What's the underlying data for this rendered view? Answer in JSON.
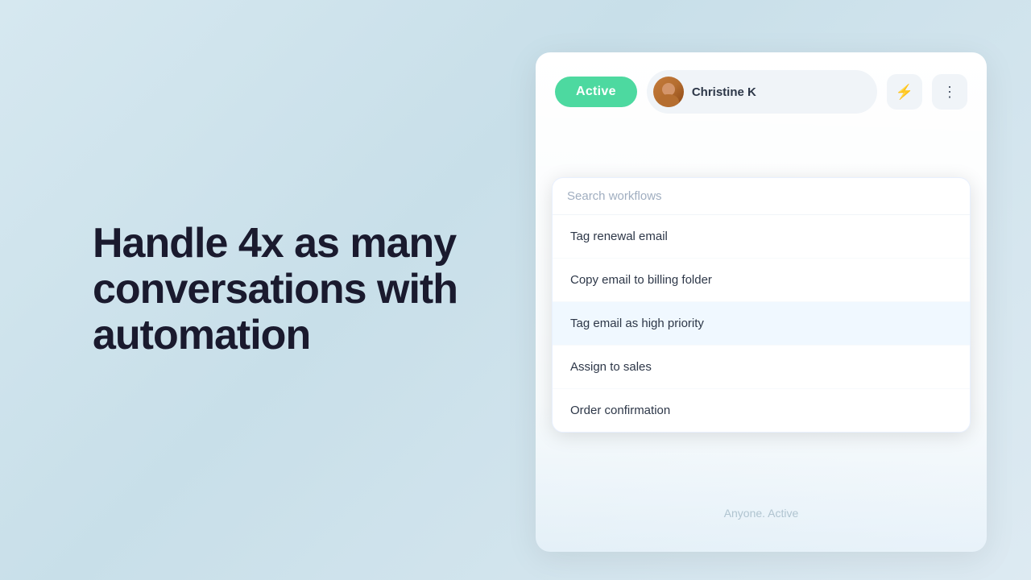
{
  "background": {
    "color_start": "#d6e8f0",
    "color_end": "#ddeef5"
  },
  "left": {
    "headline": "Handle 4x as many conversations with automation"
  },
  "panel": {
    "active_badge": "Active",
    "user_name": "Christine K",
    "search_placeholder": "Search workflows",
    "menu_items": [
      {
        "id": "tag-renewal",
        "label": "Tag renewal email",
        "highlighted": false
      },
      {
        "id": "copy-billing",
        "label": "Copy email to billing folder",
        "highlighted": false
      },
      {
        "id": "tag-high-priority",
        "label": "Tag email as high priority",
        "highlighted": true
      },
      {
        "id": "assign-sales",
        "label": "Assign to sales",
        "highlighted": false
      },
      {
        "id": "order-confirmation",
        "label": "Order confirmation",
        "highlighted": false
      }
    ],
    "bottom_status": "Anyone. Active"
  },
  "icons": {
    "lightning": "⚡",
    "more": "⋮"
  }
}
